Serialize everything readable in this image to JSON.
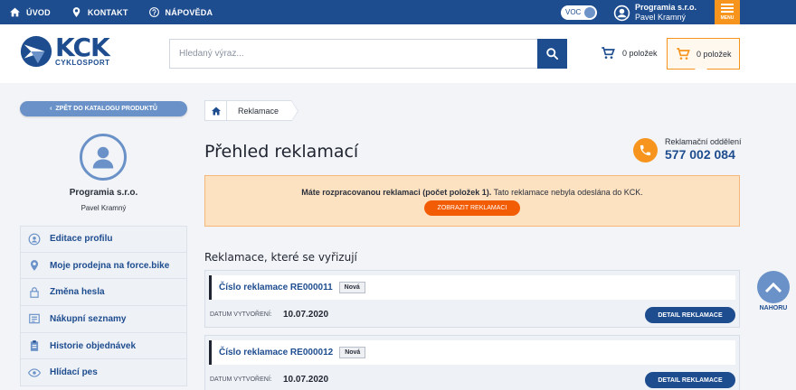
{
  "topbar": {
    "nav": [
      {
        "label": "ÚVOD",
        "icon": "home-icon"
      },
      {
        "label": "KONTAKT",
        "icon": "location-pin-icon"
      },
      {
        "label": "NÁPOVĚDA",
        "icon": "help-circle-icon"
      }
    ],
    "voc_label": "VOC",
    "user_company": "Programia s.r.o.",
    "user_name": "Pavel Kramný",
    "menu_label": "MENU"
  },
  "header": {
    "logo_main": "KCK",
    "logo_sub": "CYKLOSPORT",
    "search_placeholder": "Hledaný výraz...",
    "cart1_label": "0 položek",
    "cart2_label": "0 položek"
  },
  "sidebar": {
    "back_label": "ZPĚT DO KATALOGU PRODUKTŮ",
    "company": "Programia s.r.o.",
    "person": "Pavel Kramný",
    "items": [
      {
        "label": "Editace profilu",
        "icon": "user-circle-icon"
      },
      {
        "label": "Moje prodejna na force.bike",
        "icon": "location-pin-icon"
      },
      {
        "label": "Změna hesla",
        "icon": "lock-icon"
      },
      {
        "label": "Nákupní seznamy",
        "icon": "list-icon"
      },
      {
        "label": "Historie objednávek",
        "icon": "clipboard-icon"
      },
      {
        "label": "Hlídací pes",
        "icon": "eye-icon"
      }
    ]
  },
  "main": {
    "breadcrumb": [
      "Reklamace"
    ],
    "title": "Přehled reklamací",
    "contact_label": "Reklamační oddělení",
    "contact_phone": "577 002 084",
    "alert_bold": "Máte rozpracovanou reklamaci (počet položek 1).",
    "alert_rest": " Tato reklamace nebyla odeslána do KCK.",
    "alert_button": "ZOBRAZIT REKLAMACI",
    "section_title": "Reklamace, které se vyřizují",
    "claims": [
      {
        "title": "Číslo reklamace RE000011",
        "badge": "Nová",
        "date_label": "DATUM VYTVOŘENÍ:",
        "date": "10.07.2020",
        "button": "DETAIL REKLAMACE"
      },
      {
        "title": "Číslo reklamace RE000012",
        "badge": "Nová",
        "date_label": "DATUM VYTVOŘENÍ:",
        "date": "10.07.2020",
        "button": "DETAIL REKLAMACE"
      }
    ]
  },
  "scroll_top_label": "NAHORU",
  "colors": {
    "primary": "#1d4c8f",
    "accent": "#f7941d",
    "alert_bg": "#fde2c2",
    "light_blue": "#6a92c8"
  }
}
